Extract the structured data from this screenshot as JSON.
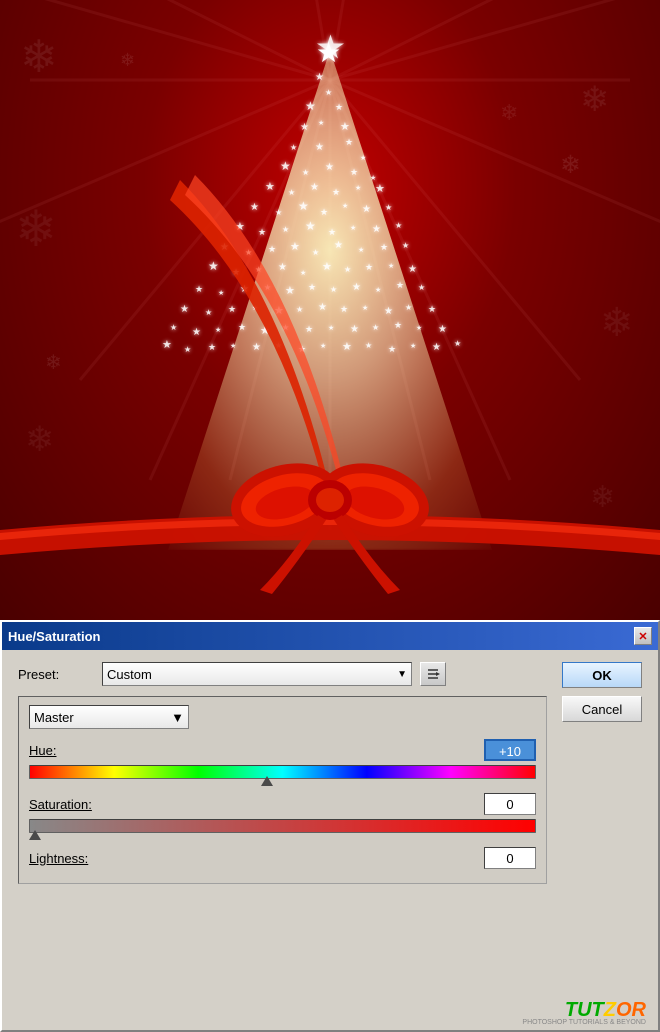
{
  "image": {
    "alt": "Christmas tree with stars and red ribbon on red background"
  },
  "dialog": {
    "title": "Hue/Saturation",
    "preset_label": "Preset:",
    "preset_value": "Custom",
    "channel_label": "Master",
    "hue_label": "Hue:",
    "hue_value": "+10",
    "saturation_label": "Saturation:",
    "saturation_value": "0",
    "lightness_label": "Lightness:",
    "lightness_value": "0",
    "ok_label": "OK",
    "cancel_label": "Cancel",
    "close_icon": "✕"
  },
  "branding": {
    "name": "TUTZOR",
    "tagline": "PHOTOSHOP TUTORIALS & BEYOND"
  }
}
